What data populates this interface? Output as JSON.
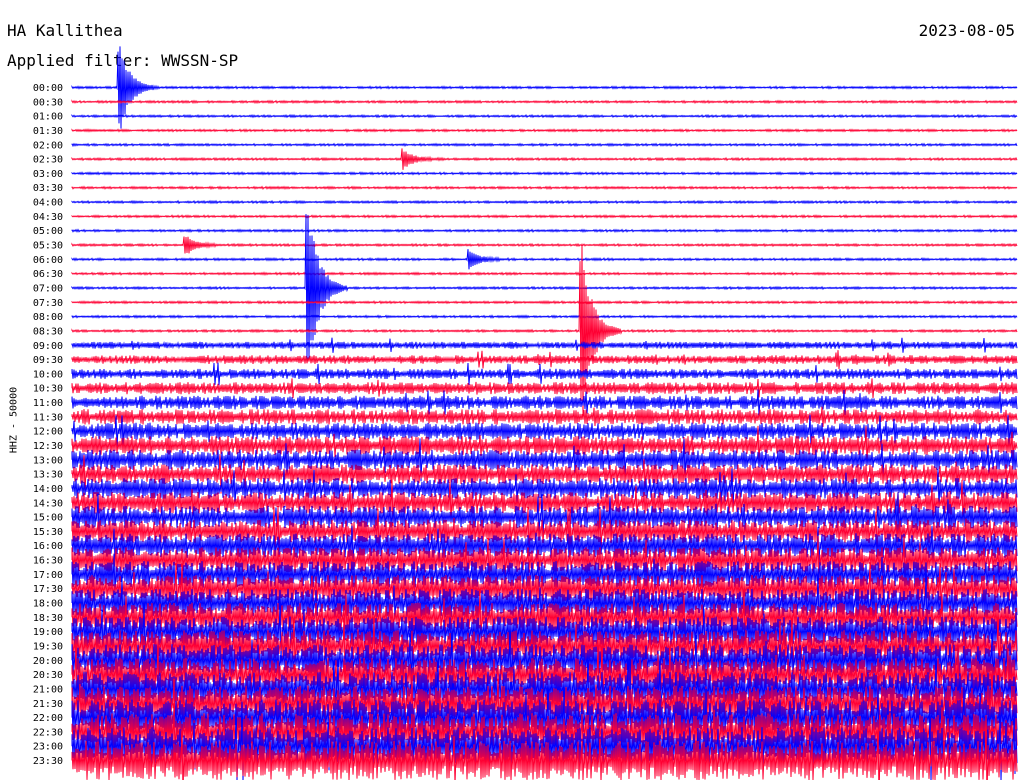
{
  "header": {
    "station": "HA Kallithea",
    "filter": "Applied filter: WWSSN-SP",
    "date": "2023-08-05"
  },
  "chart_data": {
    "type": "line",
    "title": "HA Kallithea",
    "subtitle": "Applied filter: WWSSN-SP",
    "date": "2023-08-05",
    "ylabel": "HHZ - 50000",
    "y_categories": [
      "00:00",
      "00:30",
      "01:00",
      "01:30",
      "02:00",
      "02:30",
      "03:00",
      "03:30",
      "04:00",
      "04:30",
      "05:00",
      "05:30",
      "06:00",
      "06:30",
      "07:00",
      "07:30",
      "08:00",
      "08:30",
      "09:00",
      "09:30",
      "10:00",
      "10:30",
      "11:00",
      "11:30",
      "12:00",
      "12:30",
      "13:00",
      "13:30",
      "14:00",
      "14:30",
      "15:00",
      "15:30",
      "16:00",
      "16:30",
      "17:00",
      "17:30",
      "18:00",
      "18:30",
      "19:00",
      "19:30",
      "20:00",
      "20:30",
      "21:00",
      "21:30",
      "22:00",
      "22:30",
      "23:00",
      "23:30"
    ],
    "colors": [
      "#0000ff",
      "#ff0033"
    ],
    "events": [
      {
        "row": "00:00",
        "t": 0.05,
        "amp": "large"
      },
      {
        "row": "02:30",
        "t": 0.35,
        "amp": "medium"
      },
      {
        "row": "05:30",
        "t": 0.12,
        "amp": "medium"
      },
      {
        "row": "06:00",
        "t": 0.42,
        "amp": "medium"
      },
      {
        "row": "07:00",
        "t": 0.25,
        "amp": "very-large"
      },
      {
        "row": "08:30",
        "t": 0.54,
        "amp": "very-large"
      }
    ]
  }
}
